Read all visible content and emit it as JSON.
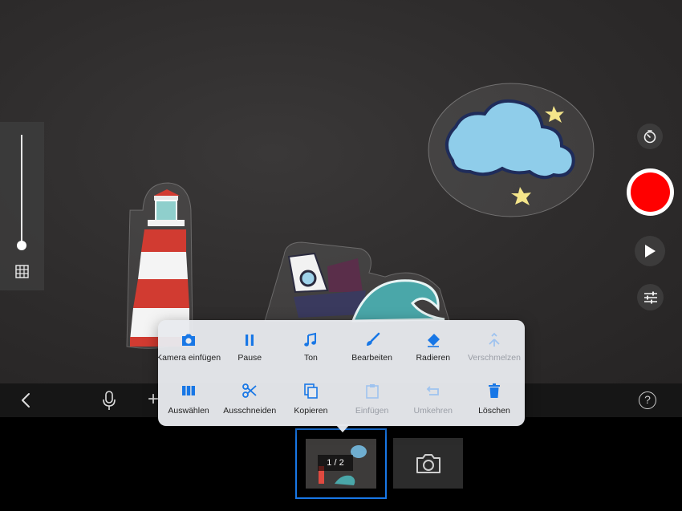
{
  "colors": {
    "accent": "#1877e6",
    "record": "#ff0000",
    "disabled_icon": "#9fc3ef",
    "disabled_text": "#9a9ea6",
    "menu_bg": "#e8eaee"
  },
  "icons": {
    "timer": "timer-icon",
    "play": "play-icon",
    "settings": "sliders-icon",
    "grid": "grid-icon",
    "back": "chevron-left-icon",
    "mic": "microphone-icon",
    "add": "plus-icon",
    "help": "help-icon",
    "capture": "camera-icon"
  },
  "zoom": {
    "level": 0.0
  },
  "toolbar": {
    "add_label": "+",
    "help_label": "?"
  },
  "filmstrip": {
    "counter": "1 / 2"
  },
  "context_menu": {
    "row1": [
      {
        "label": "Kamera einfügen",
        "icon": "camera-icon",
        "enabled": true
      },
      {
        "label": "Pause",
        "icon": "pause-icon",
        "enabled": true
      },
      {
        "label": "Ton",
        "icon": "music-note-icon",
        "enabled": true
      },
      {
        "label": "Bearbeiten",
        "icon": "brush-icon",
        "enabled": true
      },
      {
        "label": "Radieren",
        "icon": "eraser-icon",
        "enabled": true
      },
      {
        "label": "Verschmelzen",
        "icon": "merge-icon",
        "enabled": false
      }
    ],
    "row2": [
      {
        "label": "Auswählen",
        "icon": "select-frames-icon",
        "enabled": true
      },
      {
        "label": "Ausschneiden",
        "icon": "scissors-icon",
        "enabled": true
      },
      {
        "label": "Kopieren",
        "icon": "copy-icon",
        "enabled": true
      },
      {
        "label": "Einfügen",
        "icon": "clipboard-icon",
        "enabled": false
      },
      {
        "label": "Umkehren",
        "icon": "reverse-icon",
        "enabled": false
      },
      {
        "label": "Löschen",
        "icon": "trash-icon",
        "enabled": true
      }
    ]
  }
}
